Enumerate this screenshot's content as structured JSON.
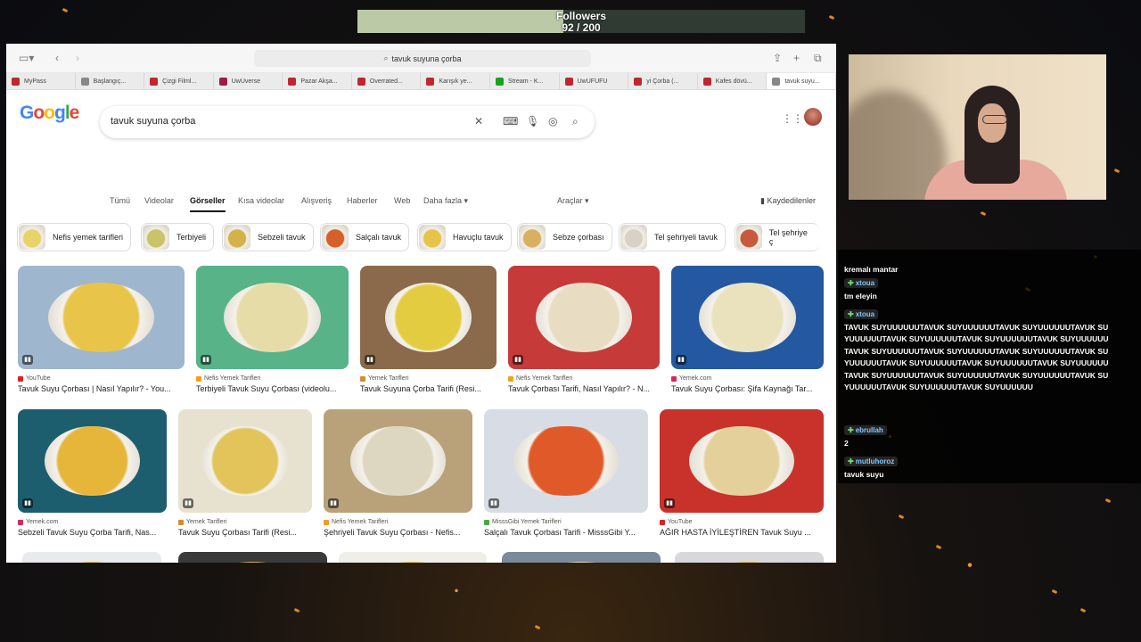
{
  "overlay": {
    "followers_label": "Followers",
    "followers_count": "92 / 200",
    "followers_progress": 0.46
  },
  "browser": {
    "url": "tavuk suyuna çorba",
    "tabs": [
      {
        "label": "MyPass",
        "color": "#c0262d"
      },
      {
        "label": "Başlangıç...",
        "color": "#888888"
      },
      {
        "label": "Çizgi Filml...",
        "color": "#c0262d"
      },
      {
        "label": "UwUverse",
        "color": "#9b1b4a"
      },
      {
        "label": "Pazar Akşa...",
        "color": "#c0262d"
      },
      {
        "label": "Overrated...",
        "color": "#c0262d"
      },
      {
        "label": "Karışık ye...",
        "color": "#c0262d"
      },
      {
        "label": "Stream - K...",
        "color": "#18a31c"
      },
      {
        "label": "UwUFUFU",
        "color": "#c0262d"
      },
      {
        "label": "yi Çorba (...",
        "color": "#c0262d"
      },
      {
        "label": "Kafes dövü...",
        "color": "#c0262d"
      },
      {
        "label": "tavuk suyu...",
        "color": "#888888"
      }
    ]
  },
  "google": {
    "logo": "Google",
    "query": "tavuk suyuna çorba",
    "nav_tabs": [
      "Tümü",
      "Videolar",
      "Görseller",
      "Kısa videolar",
      "Alışveriş",
      "Haberler",
      "Web",
      "Daha fazla ▾"
    ],
    "active_tab": "Görseller",
    "tools": "Araçlar ▾",
    "saved": "Kaydedilenler",
    "chips": [
      {
        "label": "Nefis yemek tarifleri",
        "color": "#e8d36a"
      },
      {
        "label": "Terbiyeli",
        "color": "#c9c36a"
      },
      {
        "label": "Sebzeli tavuk",
        "color": "#d4b24a"
      },
      {
        "label": "Salçalı tavuk",
        "color": "#d6602a"
      },
      {
        "label": "Havuçlu tavuk",
        "color": "#e6c44a"
      },
      {
        "label": "Sebze çorbası",
        "color": "#d8b060"
      },
      {
        "label": "Tel şehriyeli tavuk",
        "color": "#d9d2c4"
      },
      {
        "label": "Tel şehriye ç",
        "color": "#c65a3a"
      }
    ],
    "results_row1": [
      {
        "source": "YouTube",
        "title": "Tavuk Suyu Çorbası | Nasıl Yapılır? - You...",
        "soup": "#e8c448",
        "bg": "#9fb6cf",
        "src_color": "#e02020"
      },
      {
        "source": "Nefis Yemek Tarifleri",
        "title": "Terbiyeli Tavuk Suyu Çorbası (videolu...",
        "soup": "#e6dca8",
        "bg": "#58b488",
        "src_color": "#f2a01a"
      },
      {
        "source": "Yemek Tarifleri",
        "title": "Tavuk Suyuna Çorba Tarifi (Resi...",
        "soup": "#e4cc40",
        "bg": "#8a6a4a",
        "src_color": "#d88a2a"
      },
      {
        "source": "Nefis Yemek Tarifleri",
        "title": "Tavuk Çorbası Tarifi, Nasıl Yapılır? - N...",
        "soup": "#e8ddc2",
        "bg": "#c73a3a",
        "src_color": "#f2a01a"
      },
      {
        "source": "Yemek.com",
        "title": "Tavuk Suyu Çorbası: Şifa Kaynağı Tar...",
        "soup": "#e9e2bd",
        "bg": "#2458a0",
        "src_color": "#d8275a"
      }
    ],
    "results_row2": [
      {
        "source": "Yemek.com",
        "title": "Sebzeli Tavuk Suyu Çorba Tarifi, Nas...",
        "soup": "#e6b63a",
        "bg": "#1d5e6e",
        "src_color": "#d8275a"
      },
      {
        "source": "Yemek Tarifleri",
        "title": "Tavuk Suyu Çorbası Tarifi (Resi...",
        "soup": "#e2c45a",
        "bg": "#e7e2cf",
        "src_color": "#d88a2a"
      },
      {
        "source": "Nefis Yemek Tarifleri",
        "title": "Şehriyeli Tavuk Suyu Çorbası - Nefis...",
        "soup": "#ddd6c0",
        "bg": "#b9a27a",
        "src_color": "#f2a01a"
      },
      {
        "source": "MisssGibi Yemek Tarifleri",
        "title": "Salçalı Tavuk Çorbası Tarifi - MisssGibi Y...",
        "soup": "#df5a28",
        "bg": "#d8dde5",
        "src_color": "#4aa84a"
      },
      {
        "source": "YouTube",
        "title": "AĞIR HASTA İYİLEŞTİREN Tavuk Suyu ...",
        "soup": "#e4d09a",
        "bg": "#c8322a",
        "src_color": "#e02020"
      }
    ],
    "results_row3": [
      {
        "soup": "#e6c448",
        "bg": "#e8eaee"
      },
      {
        "soup": "#d9b24a",
        "bg": "#3a3a3a"
      },
      {
        "soup": "#e9cc4a",
        "bg": "#f0eee8"
      },
      {
        "soup": "#dcd8c8",
        "bg": "#7a8a9a"
      },
      {
        "soup": "#e8c44a",
        "bg": "#d8d8dc"
      }
    ]
  },
  "chat": {
    "messages": [
      {
        "user": "",
        "text": "kremalı mantar"
      },
      {
        "user": "xtoua",
        "text": "tm eleyin"
      },
      {
        "user": "xtoua",
        "text": "TAVUK SUYUUUUUUTAVUK SUYUUUUUUTAVUK SUYUUUUUUTAVUK SUYUUUUUUTAVUK SUYUUUUUUTAVUK SUYUUUUUUTAVUK SUYUUUUUUTAVUK SUYUUUUUUTAVUK SUYUUUUUUTAVUK SUYUUUUUUTAVUK SUYUUUUUUTAVUK SUYUUUUUUTAVUK SUYUUUUUUTAVUK SUYUUUUUUTAVUK SUYUUUUUUTAVUK SUYUUUUUUTAVUK SUYUUUUUUTAVUK SUYUUUUUUTAVUK SUYUUUUUUTAVUK SUYUUUUUU"
      },
      {
        "user": "ebrullah",
        "text": "2"
      },
      {
        "user": "mutluhoroz",
        "text": "tavuk suyu"
      }
    ]
  }
}
